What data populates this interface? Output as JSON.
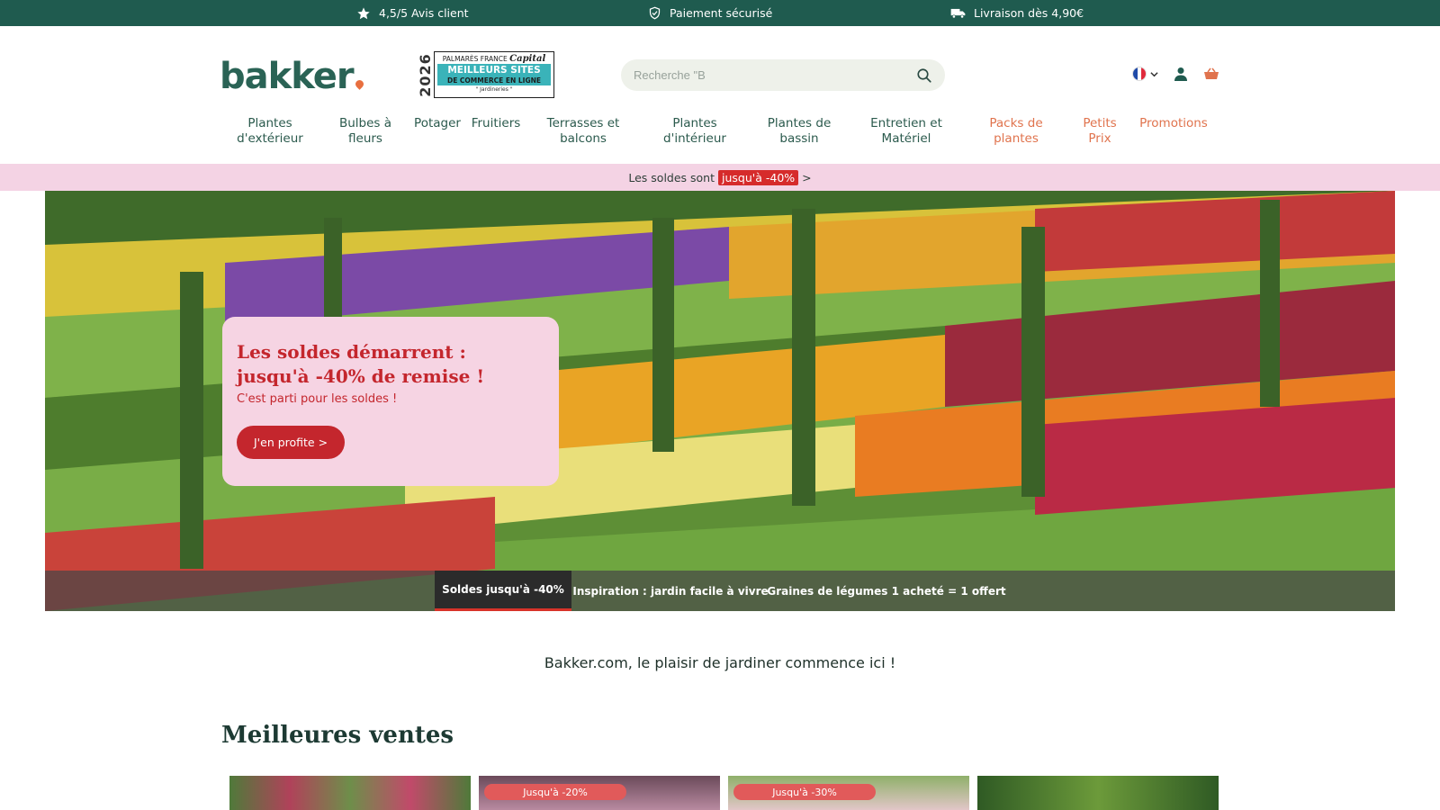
{
  "topbar": {
    "rating": "4,5/5 Avis client",
    "payment": "Paiement sécurisé",
    "delivery": "Livraison dès 4,90€"
  },
  "header": {
    "logo": "bakker",
    "award": {
      "year": "2026",
      "line1": "PALMARÈS FRANCE",
      "brand": "Capital",
      "line2": "MEILLEURS SITES",
      "line3": "DE COMMERCE EN LIGNE",
      "line4": "\" Jardineries \""
    },
    "search_placeholder": "Recherche \"B"
  },
  "nav": [
    {
      "line1": "Plantes",
      "line2": "d'extérieur"
    },
    {
      "line1": "Bulbes à",
      "line2": "fleurs"
    },
    {
      "line1": "Potager",
      "line2": ""
    },
    {
      "line1": "Fruitiers",
      "line2": ""
    },
    {
      "line1": "Terrasses et",
      "line2": "balcons"
    },
    {
      "line1": "Plantes",
      "line2": "d'intérieur"
    },
    {
      "line1": "Plantes de",
      "line2": "bassin"
    },
    {
      "line1": "Entretien et",
      "line2": "Matériel"
    },
    {
      "line1": "Packs de",
      "line2": "plantes"
    },
    {
      "line1": "Petits",
      "line2": "Prix"
    },
    {
      "line1": "Promotions",
      "line2": ""
    }
  ],
  "saleband": {
    "text": "Les soldes sont",
    "highlight": "jusqu'à -40%",
    "arrow": ">"
  },
  "hero": {
    "title": "Les soldes démarrent : jusqu'à -40% de remise !",
    "subtitle": "C'est parti pour les soldes !",
    "cta": "J'en profite >",
    "tabs": [
      "Soldes jusqu'à -40%",
      "Inspiration : jardin facile à vivre",
      "Graines de légumes 1 acheté = 1 offert"
    ]
  },
  "tagline": "Bakker.com, le plaisir de jardiner commence ici !",
  "bestsellers": {
    "title": "Meilleures ventes",
    "badges": [
      "",
      "Jusqu'à -20%",
      "Jusqu'à -30%",
      ""
    ]
  },
  "colors": {
    "brand_green": "#1f5b4f",
    "sale_pink": "#f4d3e4",
    "sale_red": "#c4262d",
    "promo_orange": "#e0734d"
  },
  "icons": [
    "star-icon",
    "shield-icon",
    "truck-icon",
    "search-icon",
    "flag-fr-icon",
    "chevron-down-icon",
    "user-icon",
    "basket-icon"
  ]
}
